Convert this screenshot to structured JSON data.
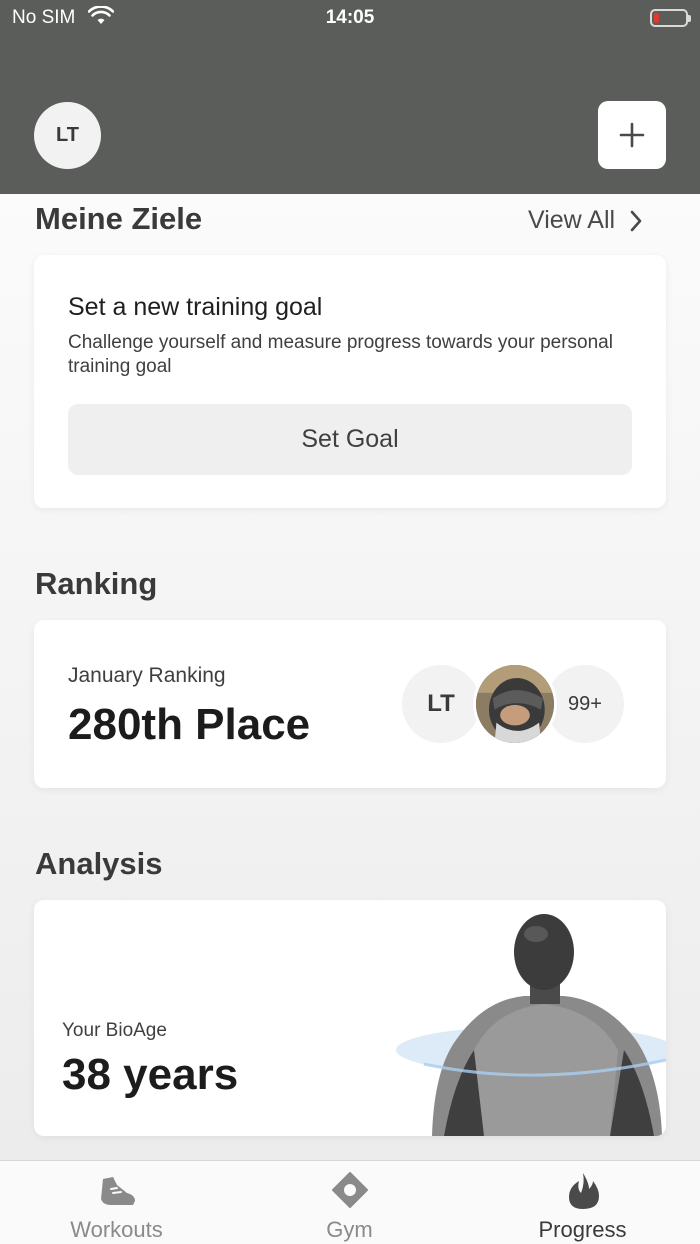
{
  "status_bar": {
    "carrier": "No SIM",
    "time": "14:05",
    "battery_color": "#e0392f"
  },
  "header": {
    "avatar_initials": "LT",
    "add_icon": "plus-icon"
  },
  "goals": {
    "section_title": "Meine Ziele",
    "view_all_label": "View All",
    "card_title": "Set a new training goal",
    "card_description": "Challenge yourself and measure progress towards your personal training goal",
    "button_label": "Set Goal"
  },
  "ranking": {
    "section_title": "Ranking",
    "label": "January Ranking",
    "value": "280th Place",
    "participants": {
      "initials": "LT",
      "more_count": "99+"
    }
  },
  "analysis": {
    "section_title": "Analysis",
    "bioage_label": "Your BioAge",
    "bioage_value": "38 years"
  },
  "tabs": [
    {
      "label": "Workouts",
      "icon": "shoe-icon",
      "active": false
    },
    {
      "label": "Gym",
      "icon": "location-pin-icon",
      "active": false
    },
    {
      "label": "Progress",
      "icon": "flame-icon",
      "active": true
    }
  ],
  "colors": {
    "header_bg": "#5a5d5a",
    "card_bg": "#ffffff",
    "button_bg": "#efefef"
  }
}
